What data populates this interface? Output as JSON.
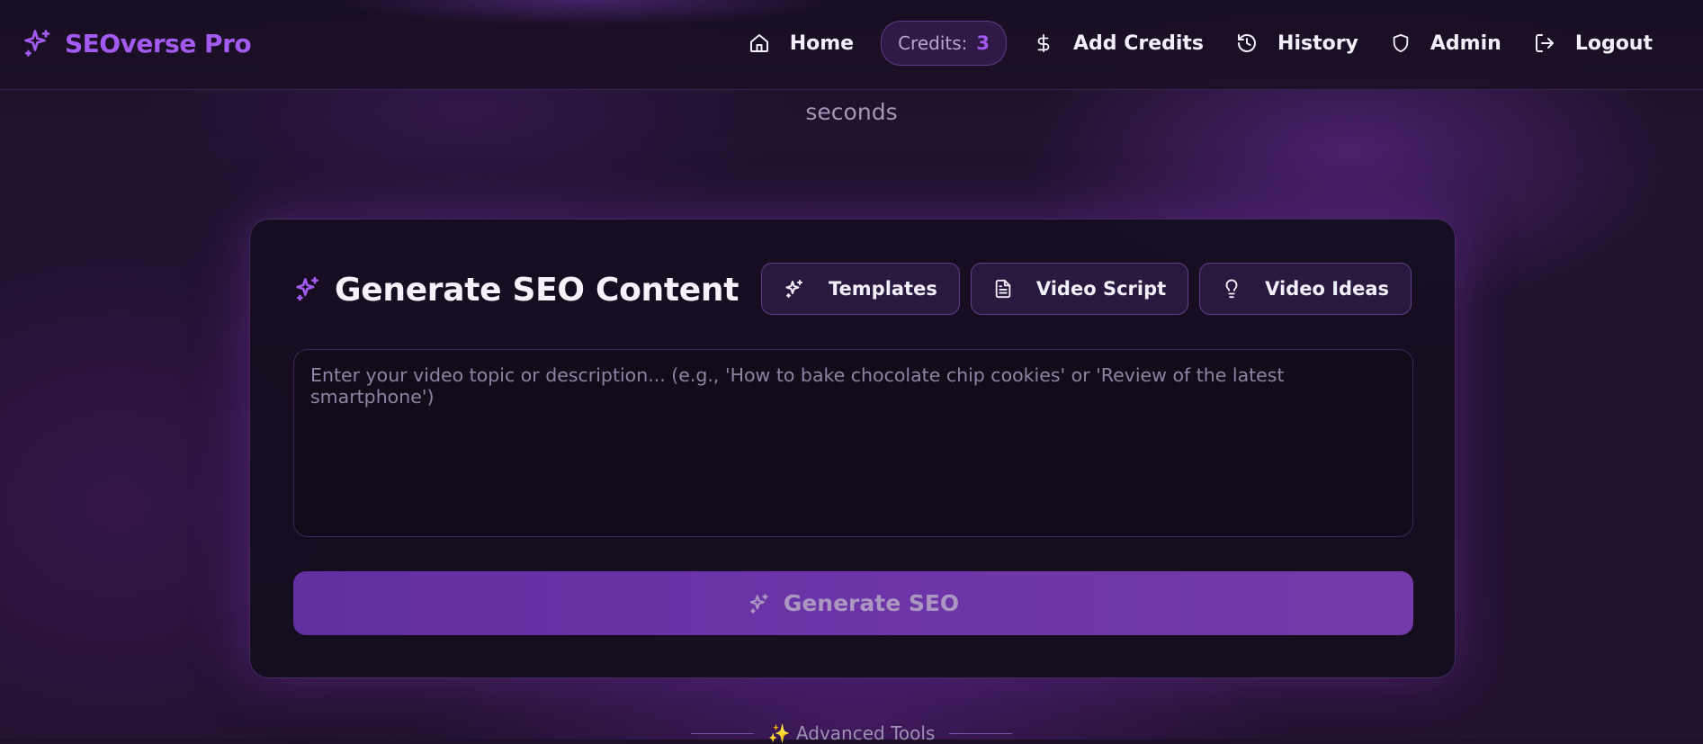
{
  "brand": {
    "name": "SEOverse Pro",
    "icon": "sparkles-icon"
  },
  "nav": {
    "home": {
      "label": "Home",
      "icon": "home-icon"
    },
    "credits": {
      "label": "Credits:",
      "value": "3"
    },
    "add_credits": {
      "label": "Add Credits",
      "icon": "dollar-icon"
    },
    "history": {
      "label": "History",
      "icon": "history-icon"
    },
    "admin": {
      "label": "Admin",
      "icon": "shield-icon"
    },
    "logout": {
      "label": "Logout",
      "icon": "logout-icon"
    }
  },
  "hero": {
    "subtitle_partial": "seconds"
  },
  "generator": {
    "title": "Generate SEO Content",
    "tools": [
      {
        "label": "Templates",
        "icon": "sparkles-icon"
      },
      {
        "label": "Video Script",
        "icon": "document-icon"
      },
      {
        "label": "Video Ideas",
        "icon": "lightbulb-icon"
      }
    ],
    "topic_placeholder": "Enter your video topic or description... (e.g., 'How to bake chocolate chip cookies' or 'Review of the latest smartphone')",
    "topic_value": "",
    "generate_label": "Generate SEO"
  },
  "advanced": {
    "label": "✨ Advanced Tools"
  },
  "colors": {
    "accent": "#a35af0",
    "background": "#1e1229",
    "button": "#6a33a6"
  }
}
